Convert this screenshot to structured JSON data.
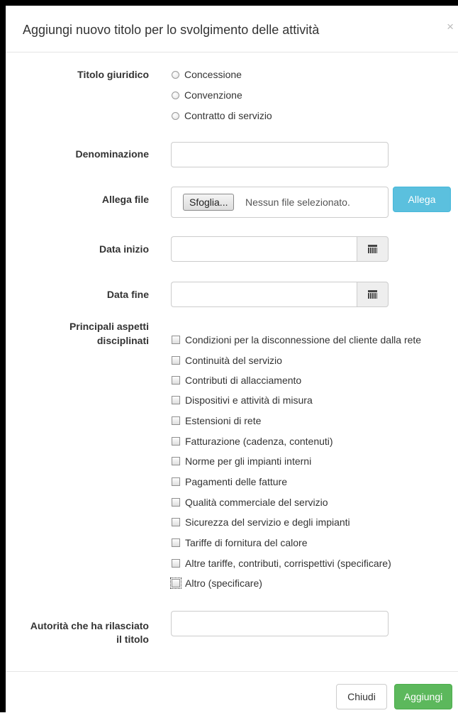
{
  "modal": {
    "title": "Aggiungi nuovo titolo per lo svolgimento delle attività",
    "close_symbol": "×"
  },
  "form": {
    "titolo_giuridico": {
      "label": "Titolo giuridico",
      "options": [
        "Concessione",
        "Convenzione",
        "Contratto di servizio"
      ],
      "selected": null
    },
    "denominazione": {
      "label": "Denominazione",
      "value": "",
      "placeholder": ""
    },
    "allega_file": {
      "label": "Allega file",
      "browse_label": "Sfoglia...",
      "status": "Nessun file selezionato.",
      "attach_button": "Allega"
    },
    "data_inizio": {
      "label": "Data inizio",
      "value": "",
      "icon": "calendar-icon"
    },
    "data_fine": {
      "label": "Data fine",
      "value": "",
      "icon": "calendar-icon"
    },
    "aspetti": {
      "label_line1": "Principali aspetti",
      "label_line2": "disciplinati",
      "options": [
        "Condizioni per la disconnessione del cliente dalla rete",
        "Continuità del servizio",
        "Contributi di allacciamento",
        "Dispositivi e attività di misura",
        "Estensioni di rete",
        "Fatturazione (cadenza, contenuti)",
        "Norme per gli impianti interni",
        "Pagamenti delle fatture",
        "Qualità commerciale del servizio",
        "Sicurezza del servizio e degli impianti",
        "Tariffe di fornitura del calore",
        "Altre tariffe, contributi, corrispettivi (specificare)",
        "Altro (specificare)"
      ]
    },
    "autorita": {
      "label_line1": "Autorità che ha rilasciato",
      "label_line2": "il titolo",
      "value": ""
    }
  },
  "footer": {
    "close_button": "Chiudi",
    "add_button": "Aggiungi"
  },
  "colors": {
    "info": "#5bc0de",
    "success": "#5cb85c",
    "border": "#cccccc"
  }
}
